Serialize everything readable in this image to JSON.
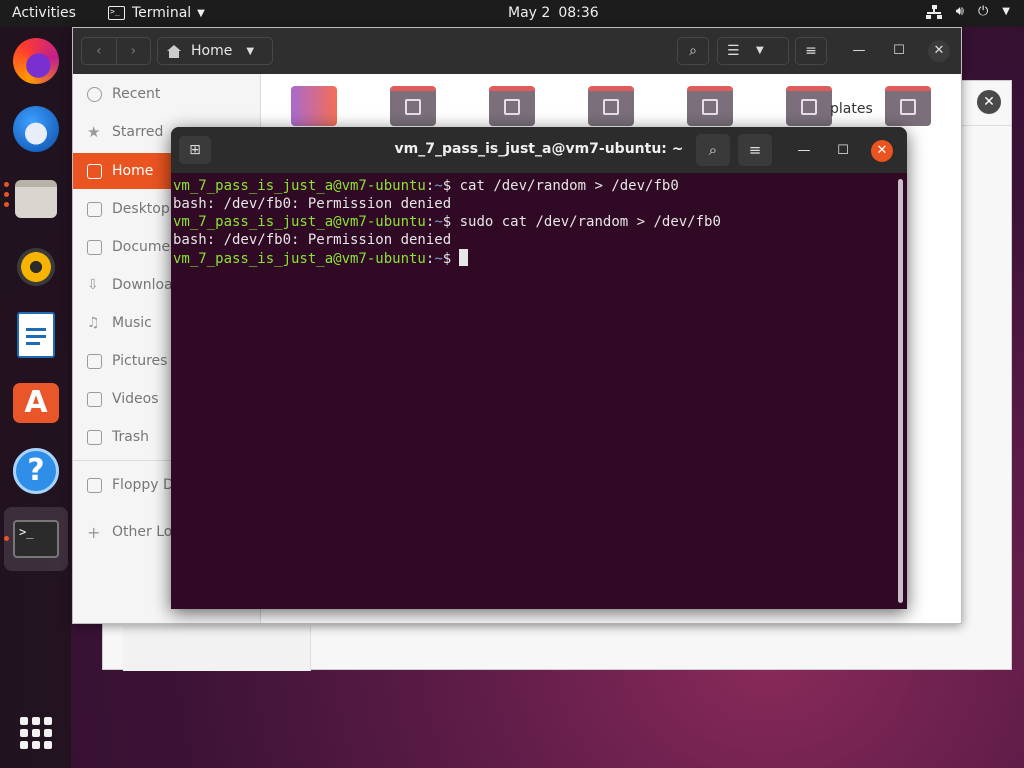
{
  "topbar": {
    "activities": "Activities",
    "app_name": "Terminal",
    "date": "May 2",
    "time": "08:36",
    "tray_icons": [
      "network-icon",
      "volume-icon",
      "power-icon",
      "chevron-down-icon"
    ]
  },
  "dock": {
    "apps": [
      "Firefox",
      "Thunderbird",
      "Files",
      "Rhythmbox",
      "LibreOffice Writer",
      "Ubuntu Software",
      "Help",
      "Terminal"
    ]
  },
  "file_manager": {
    "location": "Home",
    "sidebar": [
      {
        "label": "Recent",
        "icon": "clock-icon"
      },
      {
        "label": "Starred",
        "icon": "star-icon"
      },
      {
        "label": "Home",
        "icon": "home-icon",
        "active": true
      },
      {
        "label": "Desktop",
        "icon": "desktop-icon"
      },
      {
        "label": "Documen",
        "icon": "document-icon"
      },
      {
        "label": "Downloa",
        "icon": "download-icon"
      },
      {
        "label": "Music",
        "icon": "music-icon"
      },
      {
        "label": "Pictures",
        "icon": "picture-icon"
      },
      {
        "label": "Videos",
        "icon": "video-icon"
      },
      {
        "label": "Trash",
        "icon": "trash-icon"
      },
      {
        "label": "Floppy Di",
        "icon": "floppy-icon"
      },
      {
        "label": "Other Loc",
        "icon": "plus-icon"
      }
    ],
    "folders": [
      "desktop-folder-icon",
      "documents-folder-icon",
      "downloads-folder-icon",
      "music-folder-icon",
      "pictures-folder-icon",
      "public-folder-icon",
      "templates-folder-icon"
    ],
    "partial_label": "plates"
  },
  "terminal": {
    "title": "vm_7_pass_is_just_a@vm7-ubuntu: ~",
    "lines": [
      {
        "user": "vm_7_pass_is_just_a@vm7-ubuntu",
        "path": "~",
        "cmd": "$ cat /dev/random > /dev/fb0"
      },
      {
        "output": "bash: /dev/fb0: Permission denied"
      },
      {
        "user": "vm_7_pass_is_just_a@vm7-ubuntu",
        "path": "~",
        "cmd": "$ sudo cat /dev/random > /dev/fb0"
      },
      {
        "output": "bash: /dev/fb0: Permission denied"
      },
      {
        "user": "vm_7_pass_is_just_a@vm7-ubuntu",
        "path": "~",
        "cmd": "$"
      }
    ],
    "colors": {
      "background": "#300a24",
      "user": "#8ae234",
      "path": "#729fcf",
      "accent": "#e95420"
    }
  }
}
